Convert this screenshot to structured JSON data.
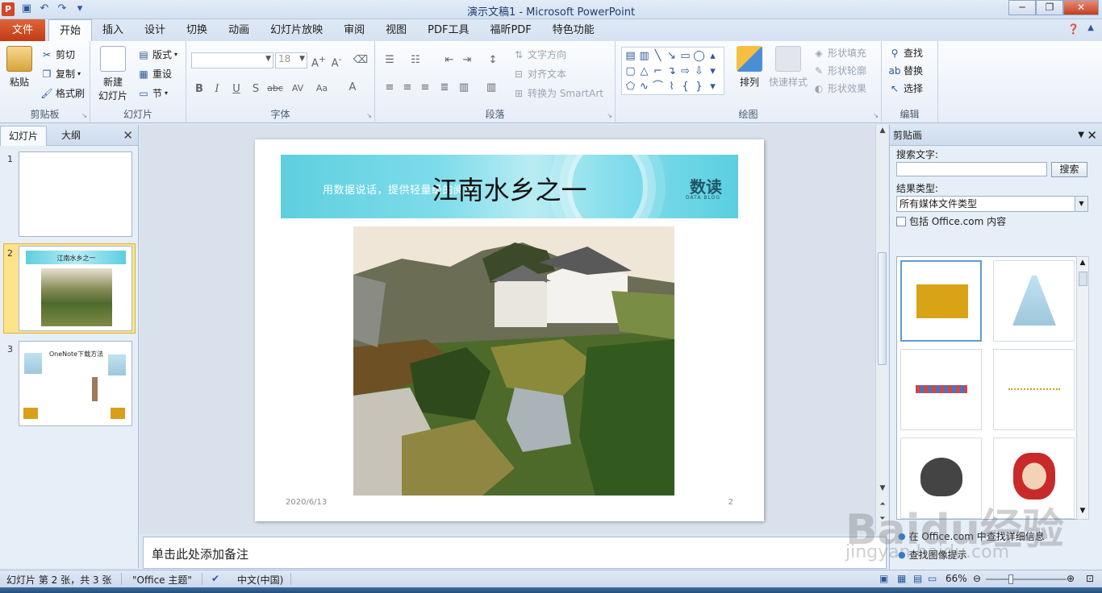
{
  "window": {
    "title": "演示文稿1  -  Microsoft PowerPoint",
    "app_icon": "P",
    "controls": [
      "─",
      "❐",
      "✕"
    ]
  },
  "qat": [
    "save-icon",
    "undo-icon",
    "redo-icon"
  ],
  "ribbon_tabs": {
    "file": "文件",
    "tabs": [
      "开始",
      "插入",
      "设计",
      "切换",
      "动画",
      "幻灯片放映",
      "审阅",
      "视图",
      "PDF工具",
      "福昕PDF",
      "特色功能"
    ],
    "active": "开始"
  },
  "ribbon": {
    "clipboard": {
      "paste": "粘贴",
      "cut": "剪切",
      "copy": "复制",
      "format_painter": "格式刷",
      "label": "剪贴板"
    },
    "slides": {
      "new_slide": "新建",
      "new_slide2": "幻灯片",
      "layout": "版式",
      "reset": "重设",
      "section": "节",
      "label": "幻灯片"
    },
    "font": {
      "family": "",
      "size": "18",
      "label": "字体"
    },
    "paragraph": {
      "text_direction": "文字方向",
      "align_text": "对齐文本",
      "smartart": "转换为 SmartArt",
      "label": "段落"
    },
    "drawing": {
      "arrange": "排列",
      "quick_styles": "快速样式",
      "fill": "形状填充",
      "outline": "形状轮廓",
      "effects": "形状效果",
      "label": "绘图"
    },
    "editing": {
      "find": "查找",
      "replace": "替换",
      "select": "选择",
      "label": "编辑"
    }
  },
  "slides_pane": {
    "tabs": [
      "幻灯片",
      "大纲"
    ],
    "numbers": [
      "1",
      "2",
      "3"
    ],
    "thumb2_title": "江南水乡之一",
    "thumb3_title": "OneNote下载方法"
  },
  "slide": {
    "title": "江南水乡之一",
    "banner_text": "用数据说话，提供轻量级的阅读",
    "brand": "数读",
    "brand_sub": "DATA BLOG",
    "date": "2020/6/13",
    "number": "2"
  },
  "notes": {
    "placeholder": "单击此处添加备注"
  },
  "clip_pane": {
    "title": "剪贴画",
    "search_label": "搜索文字:",
    "search_value": "",
    "search_button": "搜索",
    "results_label": "结果类型:",
    "results_type": "所有媒体文件类型",
    "include_office": "包括 Office.com 内容",
    "link1": "在 Office.com 中查找详细信息",
    "link2": "查找图像提示"
  },
  "status": {
    "slide_info": "幻灯片 第 2 张，共 3 张",
    "theme": "\"Office 主题\"",
    "language": "中文(中国)",
    "zoom": "66%"
  },
  "watermark": {
    "main": "Baidu经验",
    "sub": "jingyan.baidu.com"
  }
}
